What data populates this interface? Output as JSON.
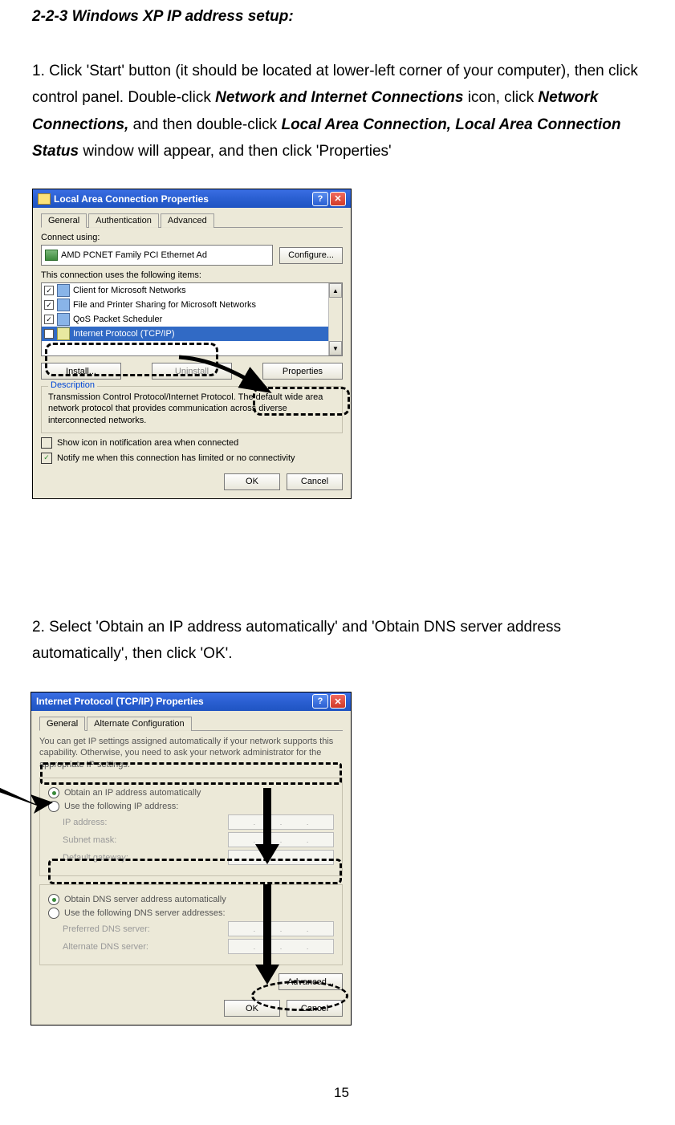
{
  "section_title": "2-2-3 Windows XP IP address setup:",
  "step1": {
    "pre": "1. Click 'Start' button (it should be located at lower-left corner of your computer), then click control panel. Double-click ",
    "bold1": "Network and Internet Connections",
    "mid1": " icon, click ",
    "bold2": "Network Connections,",
    "mid2": " and then double-click ",
    "bold3": "Local Area Connection, Local Area Connection Status",
    "post": " window will appear, and then click 'Properties'"
  },
  "dialog1": {
    "title": "Local Area Connection Properties",
    "tabs": [
      "General",
      "Authentication",
      "Advanced"
    ],
    "connect_using_label": "Connect using:",
    "nic_name": "AMD PCNET Family PCI Ethernet Ad",
    "configure_btn": "Configure...",
    "items_label": "This connection uses the following items:",
    "items": [
      "Client for Microsoft Networks",
      "File and Printer Sharing for Microsoft Networks",
      "QoS Packet Scheduler",
      "Internet Protocol (TCP/IP)"
    ],
    "install_btn": "Install...",
    "uninstall_btn": "Uninstall",
    "properties_btn": "Properties",
    "desc_legend": "Description",
    "desc_text": "Transmission Control Protocol/Internet Protocol. The default wide area network protocol that provides communication across diverse interconnected networks.",
    "show_icon": "Show icon in notification area when connected",
    "notify": "Notify me when this connection has limited or no connectivity",
    "ok": "OK",
    "cancel": "Cancel"
  },
  "step2": "2. Select 'Obtain an IP address automatically' and 'Obtain DNS server address automatically', then click 'OK'.",
  "dialog2": {
    "title": "Internet Protocol (TCP/IP) Properties",
    "tabs": [
      "General",
      "Alternate Configuration"
    ],
    "info": "You can get IP settings assigned automatically if your network supports this capability. Otherwise, you need to ask your network administrator for the appropriate IP settings.",
    "opt_auto_ip": "Obtain an IP address automatically",
    "opt_manual_ip": "Use the following IP address:",
    "ip_addr": "IP address:",
    "subnet": "Subnet mask:",
    "gateway": "Default gateway:",
    "opt_auto_dns": "Obtain DNS server address automatically",
    "opt_manual_dns": "Use the following DNS server addresses:",
    "pref_dns": "Preferred DNS server:",
    "alt_dns": "Alternate DNS server:",
    "advanced": "Advanced...",
    "ok": "OK",
    "cancel": "Cancel"
  },
  "page_number": "15"
}
